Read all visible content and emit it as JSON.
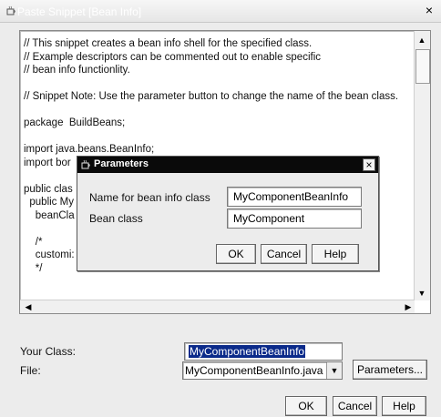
{
  "window": {
    "title": "Paste Snippet [Bean Info]",
    "close": "×"
  },
  "code": {
    "lines": [
      "// This snippet creates a bean info shell for the specified class.",
      "// Example descriptors can be commented out to enable specific",
      "// bean info functionlity.",
      "",
      "// Snippet Note: Use the parameter button to change the name of the bean class.",
      "",
      "package  BuildBeans;",
      "",
      "import java.beans.BeanInfo;",
      "import bor",
      "",
      "public clas",
      "  public My",
      "    beanCla",
      "",
      "    /*",
      "    customi:",
      "    */"
    ]
  },
  "bottom": {
    "your_class_label": "Your Class:",
    "your_class_value": "MyComponentBeanInfo",
    "file_label": "File:",
    "file_value": "MyComponentBeanInfo.java",
    "parameters_button": "Parameters...",
    "ok_button": "OK",
    "cancel_button": "Cancel",
    "help_button": "Help"
  },
  "parameters_dialog": {
    "title": "Parameters",
    "close": "×",
    "name_label": "Name for bean info class",
    "name_value": "MyComponentBeanInfo",
    "bean_class_label": "Bean class",
    "bean_class_value": "MyComponent",
    "ok_button": "OK",
    "cancel_button": "Cancel",
    "help_button": "Help"
  },
  "icons": {
    "window_icon": "cup-icon",
    "dialog_icon": "cup-icon"
  }
}
